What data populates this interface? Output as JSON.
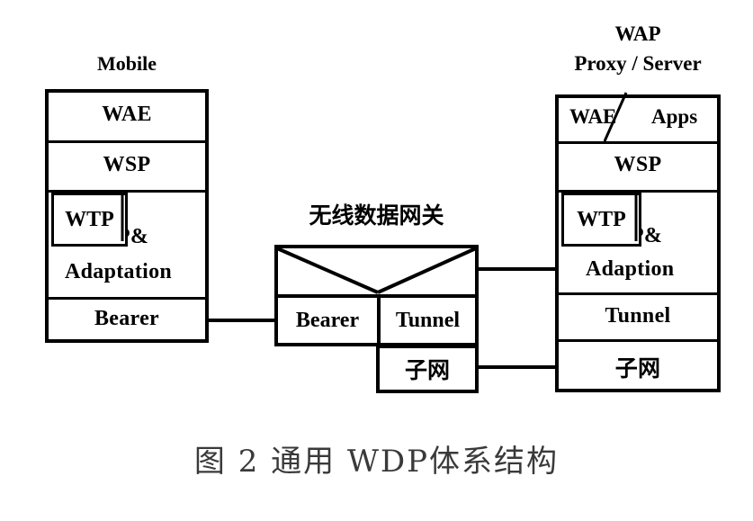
{
  "figure": {
    "caption": "图 2  通用 WDP体系结构",
    "background_color": "#ffffff",
    "line_color": "#000000",
    "caption_color": "#3a3a3a"
  },
  "mobile": {
    "heading": "Mobile",
    "layers": [
      {
        "label": "WAE"
      },
      {
        "label": "WSP"
      },
      {
        "label": "WDP&"
      },
      {
        "label": "Adaptation"
      },
      {
        "label": "Bearer"
      }
    ],
    "nested_box_label": "WTP"
  },
  "gateway": {
    "heading": "无线数据网关",
    "left_cell": "Bearer",
    "right_cell": "Tunnel",
    "bottom_cell": "子网"
  },
  "wap_proxy": {
    "heading_line1": "WAP",
    "heading_line2": "Proxy / Server",
    "layers": [
      {
        "label_left": "WAE",
        "label_right": "Apps",
        "separator": "/"
      },
      {
        "label": "WSP"
      },
      {
        "label": "WDP&"
      },
      {
        "label": "Adaption"
      },
      {
        "label": "Tunnel"
      },
      {
        "label": "子网"
      }
    ],
    "nested_box_label": "WTP"
  },
  "connectors": [
    {
      "name": "mobile-bearer-to-gateway-bearer"
    },
    {
      "name": "gateway-tunnel-to-proxy-adaption"
    },
    {
      "name": "gateway-subnet-to-proxy-subnet"
    }
  ]
}
